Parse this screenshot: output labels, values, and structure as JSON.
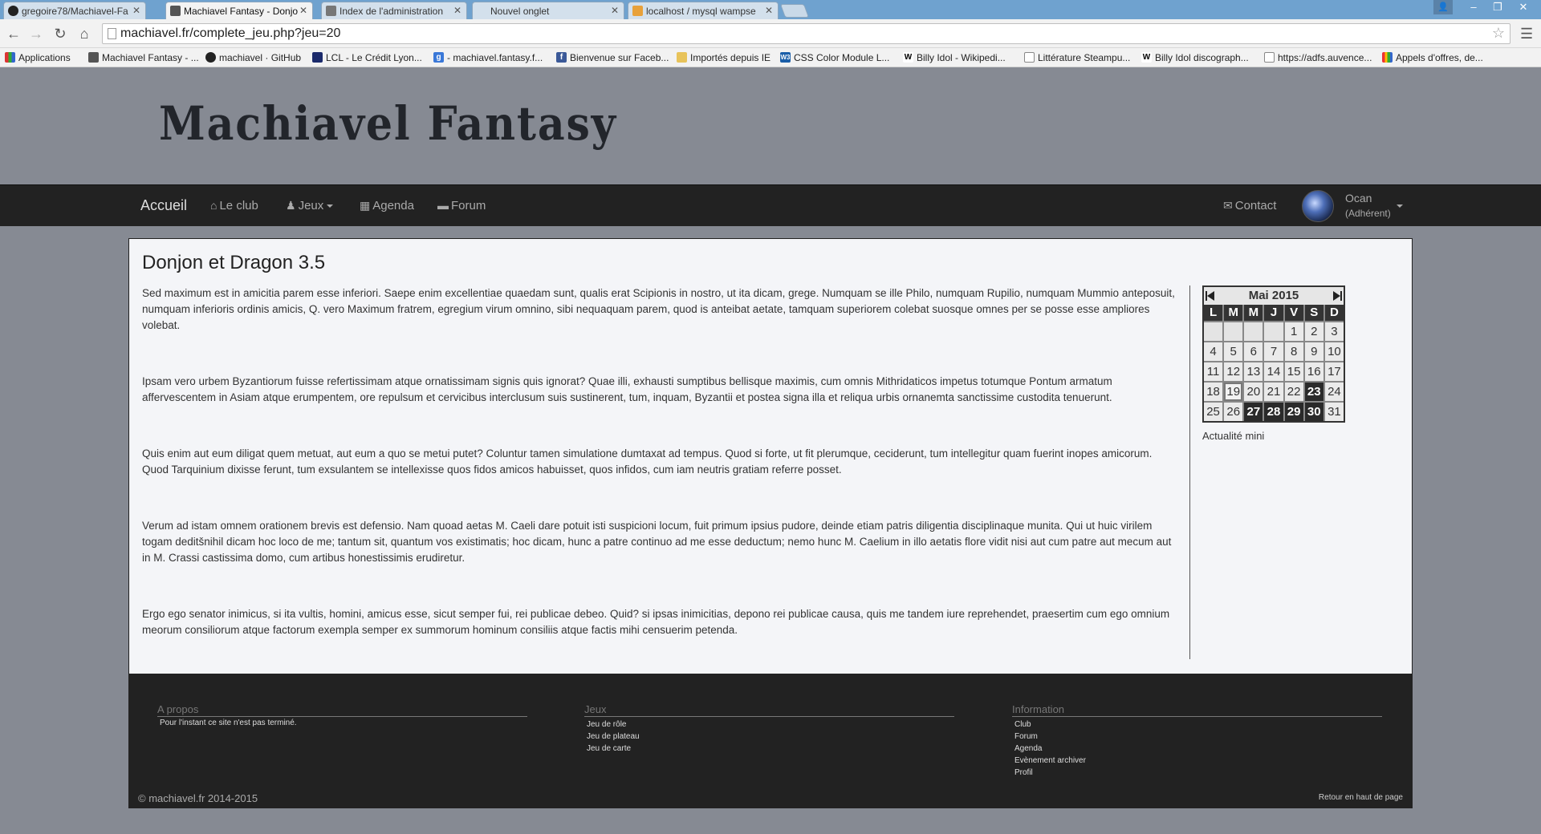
{
  "browser": {
    "tabs": [
      {
        "title": "gregoire78/Machiavel-Fa",
        "active": false
      },
      {
        "title": "Machiavel Fantasy - Donjo",
        "active": true
      },
      {
        "title": "Index de l'administration",
        "active": false
      },
      {
        "title": "Nouvel onglet",
        "active": false
      },
      {
        "title": "localhost / mysql wampse",
        "active": false
      }
    ],
    "url": "machiavel.fr/complete_jeu.php?jeu=20",
    "bookmarks": [
      {
        "label": "Applications"
      },
      {
        "label": "Machiavel Fantasy - ..."
      },
      {
        "label": "machiavel · GitHub"
      },
      {
        "label": "LCL - Le Crédit Lyon..."
      },
      {
        "label": "- machiavel.fantasy.f..."
      },
      {
        "label": "Bienvenue sur Faceb..."
      },
      {
        "label": "Importés depuis IE"
      },
      {
        "label": "CSS Color Module L..."
      },
      {
        "label": "Billy Idol - Wikipedi..."
      },
      {
        "label": "Littérature Steampu..."
      },
      {
        "label": "Billy Idol discograph..."
      },
      {
        "label": "https://adfs.auvence..."
      },
      {
        "label": "Appels d'offres, de..."
      }
    ]
  },
  "site": {
    "logo": "Machiavel Fantasy",
    "nav": {
      "brand": "Accueil",
      "club": "Le club",
      "jeux": "Jeux",
      "agenda": "Agenda",
      "forum": "Forum",
      "contact": "Contact"
    },
    "user": {
      "name": "Ocan",
      "role": "(Adhérent)"
    }
  },
  "main": {
    "title": "Donjon et Dragon 3.5",
    "paragraphs": [
      "Sed maximum est in amicitia parem esse inferiori. Saepe enim excellentiae quaedam sunt, qualis erat Scipionis in nostro, ut ita dicam, grege. Numquam se ille Philo, numquam Rupilio, numquam Mummio anteposuit, numquam inferioris ordinis amicis, Q. vero Maximum fratrem, egregium virum omnino, sibi nequaquam parem, quod is anteibat aetate, tamquam superiorem colebat suosque omnes per se posse esse ampliores volebat.",
      "Ipsam vero urbem Byzantiorum fuisse refertissimam atque ornatissimam signis quis ignorat? Quae illi, exhausti sumptibus bellisque maximis, cum omnis Mithridaticos impetus totumque Pontum armatum affervescentem in Asiam atque erumpentem, ore repulsum et cervicibus interclusum suis sustinerent, tum, inquam, Byzantii et postea signa illa et reliqua urbis ornanemta sanctissime custodita tenuerunt.",
      "Quis enim aut eum diligat quem metuat, aut eum a quo se metui putet? Coluntur tamen simulatione dumtaxat ad tempus. Quod si forte, ut fit plerumque, ceciderunt, tum intellegitur quam fuerint inopes amicorum. Quod Tarquinium dixisse ferunt, tum exsulantem se intellexisse quos fidos amicos habuisset, quos infidos, cum iam neutris gratiam referre posset.",
      "Verum ad istam omnem orationem brevis est defensio. Nam quoad aetas M. Caeli dare potuit isti suspicioni locum, fuit primum ipsius pudore, deinde etiam patris diligentia disciplinaque munita. Qui ut huic virilem togam deditšnihil dicam hoc loco de me; tantum sit, quantum vos existimatis; hoc dicam, hunc a patre continuo ad me esse deductum; nemo hunc M. Caelium in illo aetatis flore vidit nisi aut cum patre aut mecum aut in M. Crassi castissima domo, cum artibus honestissimis erudiretur.",
      "Ergo ego senator inimicus, si ita vultis, homini, amicus esse, sicut semper fui, rei publicae debeo. Quid? si ipsas inimicitias, depono rei publicae causa, quis me tandem iure reprehendet, praesertim cum ego omnium meorum consiliorum atque factorum exempla semper ex summorum hominum consiliis atque factis mihi censuerim petenda."
    ]
  },
  "calendar": {
    "month_label": "Mai 2015",
    "weekdays": [
      "L",
      "M",
      "M",
      "J",
      "V",
      "S",
      "D"
    ],
    "days": [
      [
        "",
        "",
        "",
        "",
        "1",
        "2",
        "3"
      ],
      [
        "4",
        "5",
        "6",
        "7",
        "8",
        "9",
        "10"
      ],
      [
        "11",
        "12",
        "13",
        "14",
        "15",
        "16",
        "17"
      ],
      [
        "18",
        "19",
        "20",
        "21",
        "22",
        "23",
        "24"
      ],
      [
        "25",
        "26",
        "27",
        "28",
        "29",
        "30",
        "31"
      ]
    ],
    "event_days": [
      "23",
      "27",
      "28",
      "29",
      "30"
    ],
    "today": "19",
    "footer": "Actualité mini"
  },
  "footer": {
    "about": {
      "title": "A propos",
      "text": "Pour l'instant ce site n'est pas terminé."
    },
    "jeux": {
      "title": "Jeux",
      "links": [
        "Jeu de rôle",
        "Jeu de plateau",
        "Jeu de carte"
      ]
    },
    "info": {
      "title": "Information",
      "links": [
        "Club",
        "Forum",
        "Agenda",
        "Evènement archiver",
        "Profil"
      ]
    },
    "copyright": "© machiavel.fr 2014-2015",
    "back_to_top": "Retour en haut de page"
  }
}
